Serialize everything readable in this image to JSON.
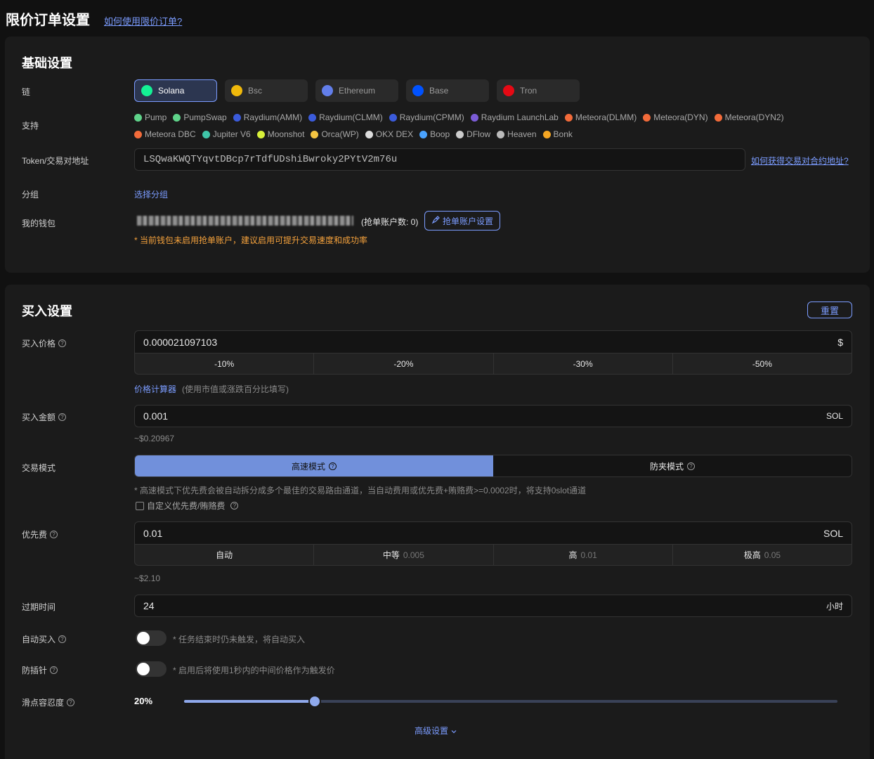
{
  "header": {
    "title": "限价订单设置",
    "help_link": "如何使用限价订单?"
  },
  "basic": {
    "title": "基础设置",
    "chain_label": "链",
    "chains": [
      {
        "name": "Solana",
        "color": "#14f195",
        "active": true
      },
      {
        "name": "Bsc",
        "color": "#f0b90b",
        "active": false
      },
      {
        "name": "Ethereum",
        "color": "#627eea",
        "active": false
      },
      {
        "name": "Base",
        "color": "#0052ff",
        "active": false
      },
      {
        "name": "Tron",
        "color": "#e50914",
        "active": false
      }
    ],
    "support_label": "支持",
    "dexes": [
      {
        "name": "Pump",
        "color": "#5fd38a"
      },
      {
        "name": "PumpSwap",
        "color": "#5fd38a"
      },
      {
        "name": "Raydium(AMM)",
        "color": "#3b5bdb"
      },
      {
        "name": "Raydium(CLMM)",
        "color": "#3b5bdb"
      },
      {
        "name": "Raydium(CPMM)",
        "color": "#3b5bdb"
      },
      {
        "name": "Raydium LaunchLab",
        "color": "#7b5cd6"
      },
      {
        "name": "Meteora(DLMM)",
        "color": "#f26b3a"
      },
      {
        "name": "Meteora(DYN)",
        "color": "#f26b3a"
      },
      {
        "name": "Meteora(DYN2)",
        "color": "#f26b3a"
      },
      {
        "name": "Meteora DBC",
        "color": "#f26b3a"
      },
      {
        "name": "Jupiter V6",
        "color": "#3fc5a8"
      },
      {
        "name": "Moonshot",
        "color": "#d8f03a"
      },
      {
        "name": "Orca(WP)",
        "color": "#f5c542"
      },
      {
        "name": "OKX DEX",
        "color": "#dddddd"
      },
      {
        "name": "Boop",
        "color": "#4aa3ff"
      },
      {
        "name": "DFlow",
        "color": "#cccccc"
      },
      {
        "name": "Heaven",
        "color": "#bbbbbb"
      },
      {
        "name": "Bonk",
        "color": "#f5a623"
      }
    ],
    "token_label": "Token/交易对地址",
    "token_value": "LSQwaKWQTYqvtDBcp7rTdfUDshiBwroky2PYtV2m76u",
    "token_help": "如何获得交易对合约地址?",
    "group_label": "分组",
    "group_link": "选择分组",
    "wallet_label": "我的钱包",
    "wallet_count": "(抢单账户数: 0)",
    "snipe_btn": "抢单账户设置",
    "warning": "* 当前钱包未启用抢单账户，建议启用可提升交易速度和成功率"
  },
  "buy": {
    "title": "买入设置",
    "reset": "重置",
    "price_label": "买入价格",
    "price_value": "0.000021097103",
    "price_unit": "$",
    "price_presets": [
      "-10%",
      "-20%",
      "-30%",
      "-50%"
    ],
    "calc_link": "价格计算器",
    "calc_hint": "(使用市值或涨跌百分比填写)",
    "amount_label": "买入金额",
    "amount_value": "0.001",
    "amount_unit": "SOL",
    "amount_usd": "~$0.20967",
    "mode_label": "交易模式",
    "mode_fast": "高速模式",
    "mode_anti": "防夹模式",
    "mode_hint": "* 高速模式下优先费会被自动拆分成多个最佳的交易路由通道，当自动费用或优先费+贿赂费>=0.0002时，将支持0slot通道",
    "custom_fee": "自定义优先费/贿赂费",
    "priority_label": "优先费",
    "priority_value": "0.01",
    "priority_unit": "SOL",
    "priority_presets": [
      {
        "label": "自动",
        "sub": ""
      },
      {
        "label": "中等",
        "sub": "0.005"
      },
      {
        "label": "高",
        "sub": "0.01"
      },
      {
        "label": "极高",
        "sub": "0.05"
      }
    ],
    "priority_usd": "~$2.10",
    "expire_label": "过期时间",
    "expire_value": "24",
    "expire_unit": "小时",
    "auto_buy_label": "自动买入",
    "auto_buy_hint": "* 任务结束时仍未触发，将自动买入",
    "anti_wick_label": "防插针",
    "anti_wick_hint": "* 启用后将使用1秒内的中间价格作为触发价",
    "slippage_label": "滑点容忍度",
    "slippage_value": "20%",
    "slippage_fraction": 0.2,
    "advanced": "高级设置"
  },
  "colors": {
    "accent": "#7b9cff",
    "warning": "#f5a23c",
    "fast_mode": "#7190db"
  }
}
